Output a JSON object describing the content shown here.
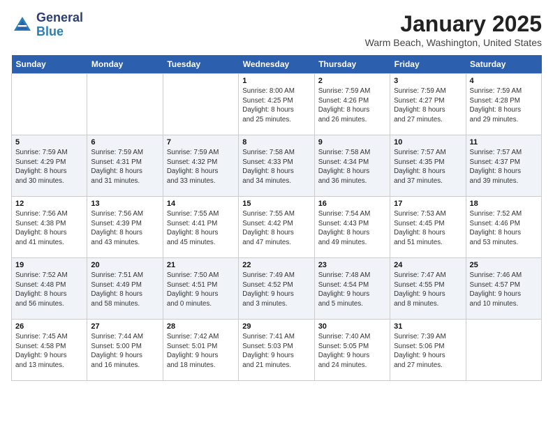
{
  "logo": {
    "general": "General",
    "blue": "Blue"
  },
  "header": {
    "month": "January 2025",
    "location": "Warm Beach, Washington, United States"
  },
  "days_of_week": [
    "Sunday",
    "Monday",
    "Tuesday",
    "Wednesday",
    "Thursday",
    "Friday",
    "Saturday"
  ],
  "weeks": [
    [
      {
        "day": "",
        "info": ""
      },
      {
        "day": "",
        "info": ""
      },
      {
        "day": "",
        "info": ""
      },
      {
        "day": "1",
        "info": "Sunrise: 8:00 AM\nSunset: 4:25 PM\nDaylight: 8 hours\nand 25 minutes."
      },
      {
        "day": "2",
        "info": "Sunrise: 7:59 AM\nSunset: 4:26 PM\nDaylight: 8 hours\nand 26 minutes."
      },
      {
        "day": "3",
        "info": "Sunrise: 7:59 AM\nSunset: 4:27 PM\nDaylight: 8 hours\nand 27 minutes."
      },
      {
        "day": "4",
        "info": "Sunrise: 7:59 AM\nSunset: 4:28 PM\nDaylight: 8 hours\nand 29 minutes."
      }
    ],
    [
      {
        "day": "5",
        "info": "Sunrise: 7:59 AM\nSunset: 4:29 PM\nDaylight: 8 hours\nand 30 minutes."
      },
      {
        "day": "6",
        "info": "Sunrise: 7:59 AM\nSunset: 4:31 PM\nDaylight: 8 hours\nand 31 minutes."
      },
      {
        "day": "7",
        "info": "Sunrise: 7:59 AM\nSunset: 4:32 PM\nDaylight: 8 hours\nand 33 minutes."
      },
      {
        "day": "8",
        "info": "Sunrise: 7:58 AM\nSunset: 4:33 PM\nDaylight: 8 hours\nand 34 minutes."
      },
      {
        "day": "9",
        "info": "Sunrise: 7:58 AM\nSunset: 4:34 PM\nDaylight: 8 hours\nand 36 minutes."
      },
      {
        "day": "10",
        "info": "Sunrise: 7:57 AM\nSunset: 4:35 PM\nDaylight: 8 hours\nand 37 minutes."
      },
      {
        "day": "11",
        "info": "Sunrise: 7:57 AM\nSunset: 4:37 PM\nDaylight: 8 hours\nand 39 minutes."
      }
    ],
    [
      {
        "day": "12",
        "info": "Sunrise: 7:56 AM\nSunset: 4:38 PM\nDaylight: 8 hours\nand 41 minutes."
      },
      {
        "day": "13",
        "info": "Sunrise: 7:56 AM\nSunset: 4:39 PM\nDaylight: 8 hours\nand 43 minutes."
      },
      {
        "day": "14",
        "info": "Sunrise: 7:55 AM\nSunset: 4:41 PM\nDaylight: 8 hours\nand 45 minutes."
      },
      {
        "day": "15",
        "info": "Sunrise: 7:55 AM\nSunset: 4:42 PM\nDaylight: 8 hours\nand 47 minutes."
      },
      {
        "day": "16",
        "info": "Sunrise: 7:54 AM\nSunset: 4:43 PM\nDaylight: 8 hours\nand 49 minutes."
      },
      {
        "day": "17",
        "info": "Sunrise: 7:53 AM\nSunset: 4:45 PM\nDaylight: 8 hours\nand 51 minutes."
      },
      {
        "day": "18",
        "info": "Sunrise: 7:52 AM\nSunset: 4:46 PM\nDaylight: 8 hours\nand 53 minutes."
      }
    ],
    [
      {
        "day": "19",
        "info": "Sunrise: 7:52 AM\nSunset: 4:48 PM\nDaylight: 8 hours\nand 56 minutes."
      },
      {
        "day": "20",
        "info": "Sunrise: 7:51 AM\nSunset: 4:49 PM\nDaylight: 8 hours\nand 58 minutes."
      },
      {
        "day": "21",
        "info": "Sunrise: 7:50 AM\nSunset: 4:51 PM\nDaylight: 9 hours\nand 0 minutes."
      },
      {
        "day": "22",
        "info": "Sunrise: 7:49 AM\nSunset: 4:52 PM\nDaylight: 9 hours\nand 3 minutes."
      },
      {
        "day": "23",
        "info": "Sunrise: 7:48 AM\nSunset: 4:54 PM\nDaylight: 9 hours\nand 5 minutes."
      },
      {
        "day": "24",
        "info": "Sunrise: 7:47 AM\nSunset: 4:55 PM\nDaylight: 9 hours\nand 8 minutes."
      },
      {
        "day": "25",
        "info": "Sunrise: 7:46 AM\nSunset: 4:57 PM\nDaylight: 9 hours\nand 10 minutes."
      }
    ],
    [
      {
        "day": "26",
        "info": "Sunrise: 7:45 AM\nSunset: 4:58 PM\nDaylight: 9 hours\nand 13 minutes."
      },
      {
        "day": "27",
        "info": "Sunrise: 7:44 AM\nSunset: 5:00 PM\nDaylight: 9 hours\nand 16 minutes."
      },
      {
        "day": "28",
        "info": "Sunrise: 7:42 AM\nSunset: 5:01 PM\nDaylight: 9 hours\nand 18 minutes."
      },
      {
        "day": "29",
        "info": "Sunrise: 7:41 AM\nSunset: 5:03 PM\nDaylight: 9 hours\nand 21 minutes."
      },
      {
        "day": "30",
        "info": "Sunrise: 7:40 AM\nSunset: 5:05 PM\nDaylight: 9 hours\nand 24 minutes."
      },
      {
        "day": "31",
        "info": "Sunrise: 7:39 AM\nSunset: 5:06 PM\nDaylight: 9 hours\nand 27 minutes."
      },
      {
        "day": "",
        "info": ""
      }
    ]
  ]
}
